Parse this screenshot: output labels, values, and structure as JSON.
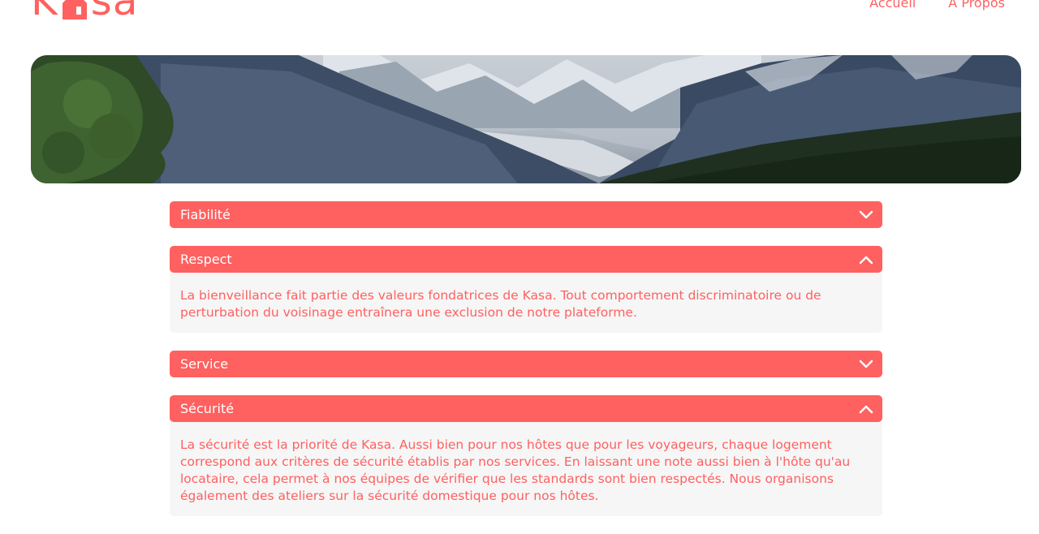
{
  "header": {
    "logo": {
      "text_before": "K",
      "text_after": "sa",
      "icon": "house-icon"
    },
    "nav": [
      {
        "label": "Accueil"
      },
      {
        "label": "A Propos"
      }
    ]
  },
  "banner": {
    "icon": "mountain-landscape-image"
  },
  "collapses": [
    {
      "title": "Fiabilité",
      "open": false,
      "icon": "chevron-down-icon",
      "content": ""
    },
    {
      "title": "Respect",
      "open": true,
      "icon": "chevron-up-icon",
      "content": "La bienveillance fait partie des valeurs fondatrices de Kasa. Tout comportement discriminatoire ou de perturbation du voisinage entraînera une exclusion de notre plateforme."
    },
    {
      "title": "Service",
      "open": false,
      "icon": "chevron-down-icon",
      "content": ""
    },
    {
      "title": "Sécurité",
      "open": true,
      "icon": "chevron-up-icon",
      "content": "La sécurité est la priorité de Kasa. Aussi bien pour nos hôtes que pour les voyageurs, chaque logement correspond aux critères de sécurité établis par nos services. En laissant une note aussi bien à l'hôte qu'au locataire, cela permet à nos équipes de vérifier que les standards sont bien respectés. Nous organisons également des ateliers sur la sécurité domestique pour nos hôtes."
    }
  ],
  "colors": {
    "primary": "#FF6060",
    "panel_bg": "#F6F6F6",
    "white": "#FFFFFF"
  }
}
